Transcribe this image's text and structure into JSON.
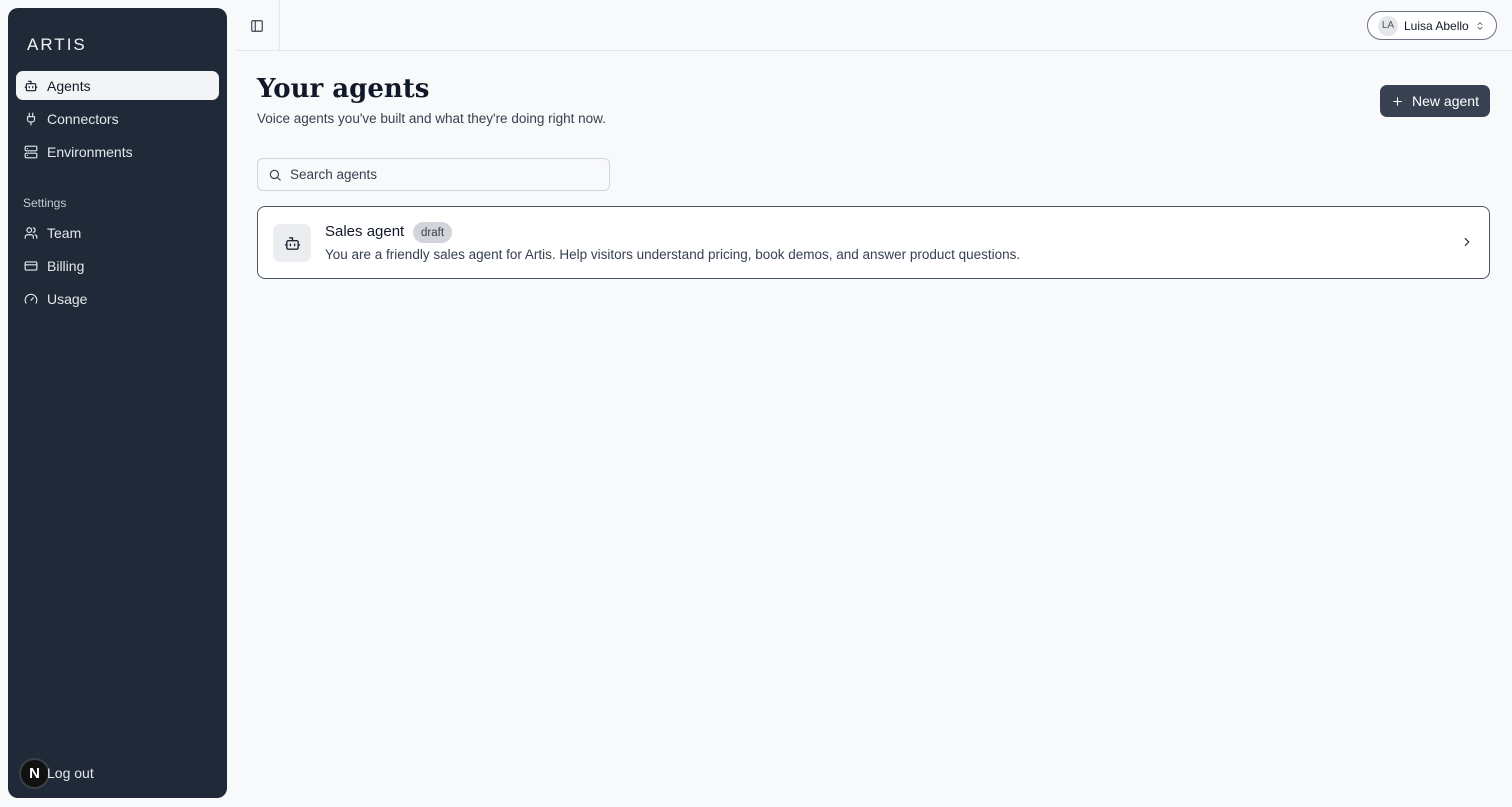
{
  "brand": {
    "logo_text": "ARTIS"
  },
  "sidebar": {
    "main_items": [
      {
        "label": "Agents",
        "icon": "bot-icon",
        "active": true
      },
      {
        "label": "Connectors",
        "icon": "plug-icon",
        "active": false
      },
      {
        "label": "Environments",
        "icon": "server-icon",
        "active": false
      }
    ],
    "settings_label": "Settings",
    "settings_items": [
      {
        "label": "Team",
        "icon": "users-icon"
      },
      {
        "label": "Billing",
        "icon": "credit-card-icon"
      },
      {
        "label": "Usage",
        "icon": "gauge-icon"
      }
    ],
    "logout_label": "Log out",
    "dev_badge": "N"
  },
  "topbar": {
    "user_initials": "LA",
    "user_name": "Luisa Abello"
  },
  "main": {
    "title": "Your agents",
    "subtitle": "Voice agents you've built and what they're doing right now.",
    "new_button_label": "New agent",
    "search_placeholder": "Search agents",
    "agents": [
      {
        "name": "Sales agent",
        "status": "draft",
        "description": "You are a friendly sales agent for Artis. Help visitors understand pricing, book demos, and answer product questions."
      }
    ]
  },
  "colors": {
    "sidebar_bg": "#1f2937",
    "primary_button": "#374151",
    "page_bg": "#f8f9fa"
  }
}
